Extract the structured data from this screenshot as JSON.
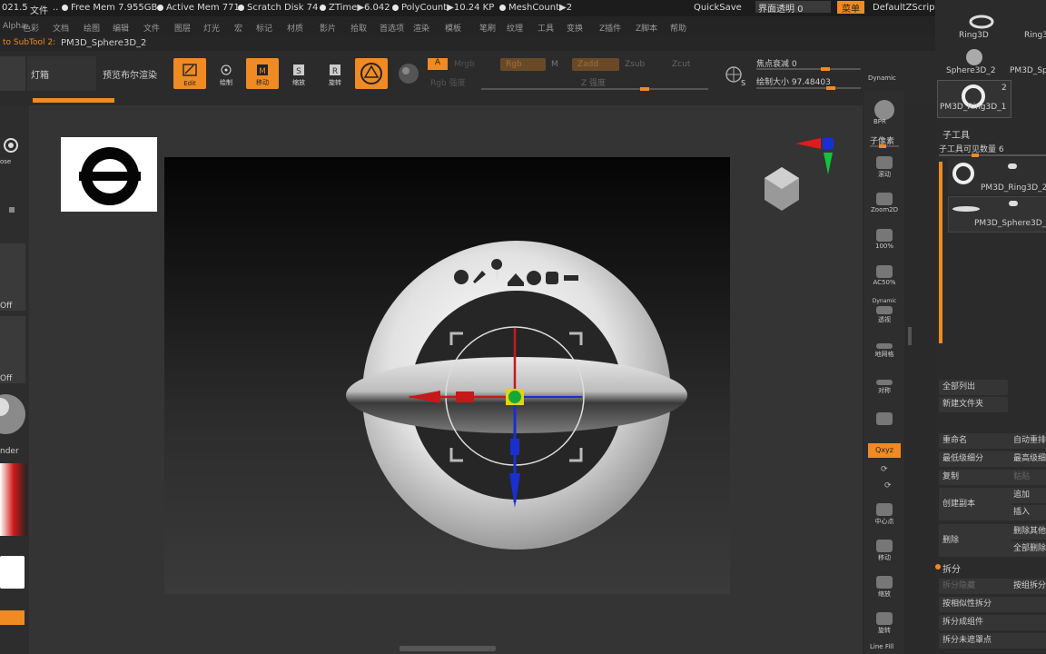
{
  "status": {
    "version_fragment": "021.5",
    "file_menu": "文件",
    "ellipsis": "..",
    "free_mem": "Free Mem 7.955GB",
    "active_mem": "Active Mem 771",
    "scratch_disk": "Scratch Disk 74",
    "ztime": "ZTime▶6.042",
    "polycount": "PolyCount▶10.24 KP",
    "meshcount": "MeshCount▶2",
    "quicksave": "QuickSave",
    "interface_transparency": "界面透明 0",
    "menu_button": "菜单",
    "default_script": "DefaultZScript"
  },
  "menubar": {
    "items": [
      "Alpha",
      "色彩",
      "文档",
      "绘图",
      "编辑",
      "文件",
      "图层",
      "灯光",
      "宏",
      "标记",
      "材质",
      "影片",
      "拾取",
      "首选项",
      "渲染",
      "模板",
      "笔刷",
      "纹理",
      "工具",
      "变换",
      "Z插件",
      "Z脚本",
      "帮助"
    ]
  },
  "subtool_path": {
    "prefix": "to SubTool 2:",
    "name": "PM3D_Sphere3D_2"
  },
  "toolbar": {
    "lightbox": "灯箱",
    "preview_render": "预览布尔渲染",
    "edit": "Edit",
    "draw": "绘制",
    "move": "移动",
    "scale": "缩放",
    "rotate": "旋转",
    "mrgb": "Mrgb",
    "rgb": "Rgb",
    "m": "M",
    "zadd": "Zadd",
    "zsub": "Zsub",
    "rgb_strength": "Rgb 强度",
    "z_strength": "Z 强度",
    "a_label": "A",
    "focal_shift": "焦点衰减 0",
    "draw_size": "绘制大小 97.48403",
    "dynamic": "Dynamic"
  },
  "left_panel": {
    "off1": "Off",
    "off2": "Off",
    "render_label": "nder",
    "close_label": "ose"
  },
  "shelf": {
    "bpr": "BPR",
    "subpixel": "子像素",
    "scroll": "滚动",
    "zoom2d": "Zoom2D",
    "p100": "100%",
    "ac50": "AC50%",
    "dynamic": "Dynamic",
    "perspective": "透视",
    "floor": "地网格",
    "local": "对称",
    "xyz": "Qxyz",
    "frame": "中心点",
    "move": "移动",
    "zoom3d": "缩放",
    "rotate": "旋转",
    "linefill": "Line Fill"
  },
  "tool_panel": {
    "top_items": [
      "Ring3D",
      "Ring3D",
      "Sphere3D_2",
      "PM3D_Sp",
      "PM3D_Ring3D_1"
    ],
    "thumb_count": "2",
    "subtool_header": "子工具",
    "visible_count": "子工具可见数量 6",
    "subtools": [
      "PM3D_Ring3D_2",
      "PM3D_Sphere3D_2"
    ],
    "list_all": "全部列出",
    "new_folder": "新建文件夹",
    "rename": "重命名",
    "auto_reorder": "自动重排",
    "lowest_sub": "最低级细分",
    "highest_sub": "最高级细分",
    "copy": "复制",
    "paste": "粘贴",
    "create_copy": "创建副本",
    "append": "追加",
    "insert": "插入",
    "delete": "删除",
    "delete_other": "删除其他",
    "delete_all": "全部删除",
    "split_header": "拆分",
    "split_hidden": "拆分隐藏",
    "split_by_group": "按组拆分",
    "split_by_similar": "按相似性拆分",
    "split_to_parts": "拆分成组件",
    "split_unmasked": "拆分未遮罩点"
  },
  "colors": {
    "accent": "#f08a22",
    "panel": "#2b2b2b",
    "gizmo_red": "#c41a1a",
    "gizmo_blue": "#1a2fd0",
    "gizmo_green": "#13a83a",
    "gizmo_yellow": "#e2d21b"
  }
}
